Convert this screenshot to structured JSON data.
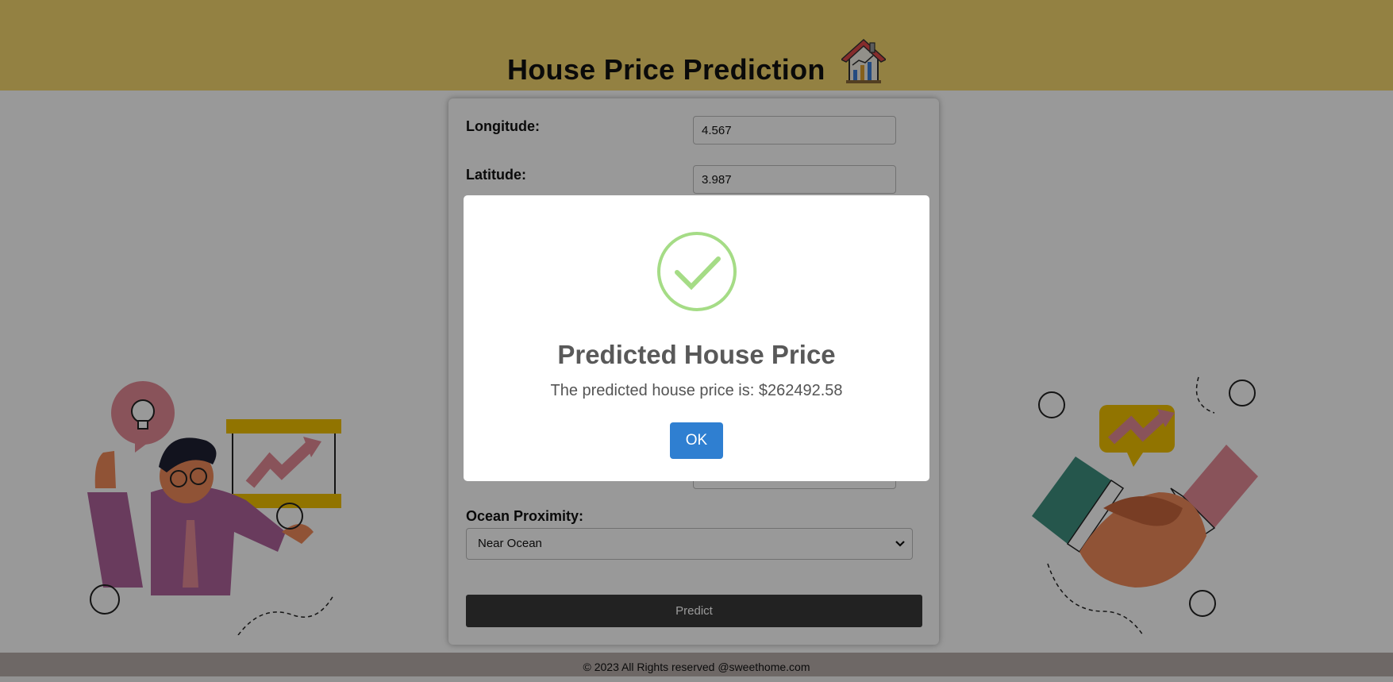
{
  "header": {
    "title": "House Price Prediction"
  },
  "form": {
    "fields": [
      {
        "label": "Longitude:",
        "value": "4.567"
      },
      {
        "label": "Latitude:",
        "value": "3.987"
      }
    ],
    "ocean": {
      "label": "Ocean Proximity:",
      "selected": "Near Ocean"
    },
    "predict_label": "Predict"
  },
  "modal": {
    "title": "Predicted House Price",
    "message": "The predicted house price is: $262492.58",
    "ok_label": "OK"
  },
  "footer": {
    "text": "© 2023 All Rights reserved @sweethome.com"
  },
  "colors": {
    "header_bg": "#f5d76e",
    "predict_button": "#3a3a3a",
    "ok_button": "#2f7fd1",
    "success_check": "#a5dc86"
  }
}
